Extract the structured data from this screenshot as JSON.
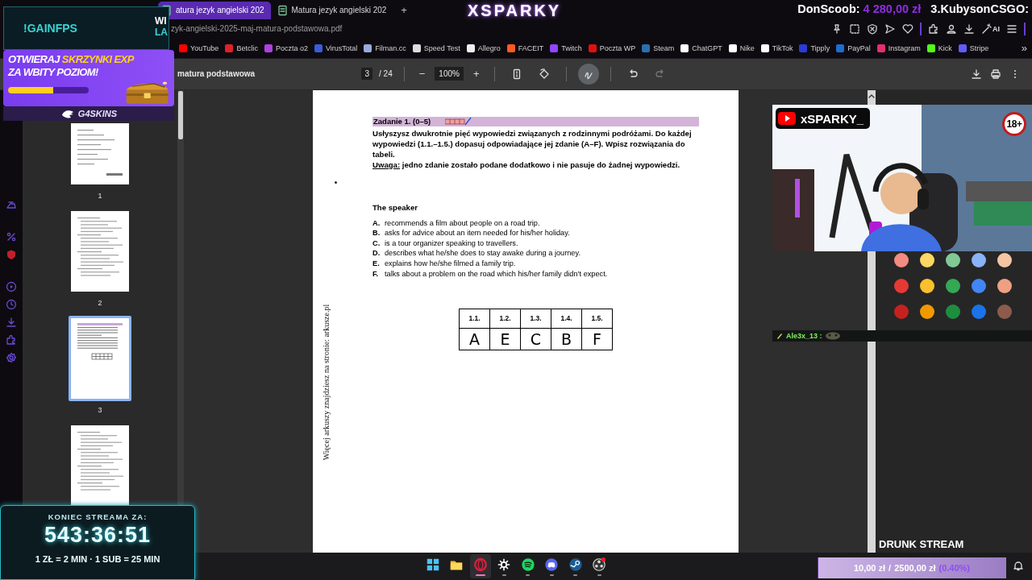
{
  "browser": {
    "tabs": [
      {
        "label": "atura jezyk angielski 202",
        "selected": true
      },
      {
        "label": "Matura jezyk angielski 202",
        "selected": false
      }
    ],
    "new_tab": "+",
    "address": "zyk-angielski-2025-maj-matura-podstawowa.pdf",
    "ai_label": "AI",
    "bookmarks": [
      {
        "label": "YouTube"
      },
      {
        "label": "Betclic"
      },
      {
        "label": "Poczta o2"
      },
      {
        "label": "VirusTotal"
      },
      {
        "label": "Filman.cc"
      },
      {
        "label": "Speed Test"
      },
      {
        "label": "Allegro"
      },
      {
        "label": "FACEIT"
      },
      {
        "label": "Twitch"
      },
      {
        "label": "Poczta WP"
      },
      {
        "label": "Steam"
      },
      {
        "label": "ChatGPT"
      },
      {
        "label": "Nike"
      },
      {
        "label": "TikTok"
      },
      {
        "label": "Tipply"
      },
      {
        "label": "PayPal"
      },
      {
        "label": "Instagram"
      },
      {
        "label": "Kick"
      },
      {
        "label": "Stripe"
      }
    ],
    "more_bookmarks": "»"
  },
  "pdf_toolbar": {
    "title": "matura podstawowa",
    "page": "3",
    "page_count": "/ 24",
    "zoom_out": "−",
    "zoom": "100%",
    "zoom_in": "+",
    "tools": [
      {
        "kind": "fit",
        "on": false,
        "disabled": false
      },
      {
        "kind": "rotate",
        "on": false,
        "disabled": false
      },
      {
        "kind": "draw",
        "on": true,
        "disabled": false
      },
      {
        "kind": "undo",
        "on": false,
        "disabled": false
      },
      {
        "kind": "redo",
        "on": false,
        "disabled": true
      }
    ]
  },
  "thumbnails": [
    {
      "label": "1",
      "selected": false,
      "kind": "cover"
    },
    {
      "label": "2",
      "selected": false,
      "kind": "text"
    },
    {
      "label": "3",
      "selected": true,
      "kind": "table"
    },
    {
      "selected": false,
      "kind": "text"
    }
  ],
  "page": {
    "task_title": "Zadanie 1. (0–5)",
    "instruction": "Usłyszysz dwukrotnie pięć wypowiedzi związanych z rodzinnymi podróżami. Do każdej wypowiedzi (1.1.–1.5.) dopasuj odpowiadające jej zdanie (A–F). Wpisz rozwiązania do tabeli.",
    "note": "**Uwaga:** jedno zdanie zostało podane dodatkowo i nie pasuje do żadnej wypowiedzi.",
    "heading": "The speaker",
    "options": [
      {
        "letter": "A.",
        "text": "recommends a film about people on a road trip."
      },
      {
        "letter": "B.",
        "text": "asks for advice about an item needed for his/her holiday."
      },
      {
        "letter": "C.",
        "text": "is a tour organizer speaking to travellers."
      },
      {
        "letter": "D.",
        "text": "describes what he/she does to stay awake during a journey."
      },
      {
        "letter": "E.",
        "text": "explains how he/she filmed a family trip."
      },
      {
        "letter": "F.",
        "text": "talks about a problem on the road which his/her family didn’t expect."
      }
    ],
    "table": {
      "columns": [
        "1.1.",
        "1.2.",
        "1.3.",
        "1.4.",
        "1.5."
      ],
      "answers": [
        "A",
        "E",
        "C",
        "B",
        "F"
      ]
    },
    "side_note": "Więcej arkuszy znajdziesz na stronie: arkusze.pl"
  },
  "color_palette": [
    {
      "color": "#f28b82"
    },
    {
      "color": "#fdd663"
    },
    {
      "color": "#81c995"
    },
    {
      "color": "#8ab4f8"
    },
    {
      "color": "#f6c5a4"
    },
    {
      "color": "#e53935"
    },
    {
      "color": "#fbc02d"
    },
    {
      "color": "#34a853"
    },
    {
      "color": "#4285f4"
    },
    {
      "color": "#eea083"
    },
    {
      "color": "#c5221f"
    },
    {
      "color": "#f29900"
    },
    {
      "color": "#1e8e3e"
    },
    {
      "color": "#1a73e8"
    },
    {
      "color": "#8d5b4c"
    }
  ],
  "taskbar": [
    {
      "kind": "start",
      "selected": false,
      "running": false
    },
    {
      "kind": "files",
      "selected": false,
      "running": false
    },
    {
      "kind": "browser",
      "selected": true,
      "running": true
    },
    {
      "kind": "gear",
      "selected": false,
      "running": true
    },
    {
      "kind": "music",
      "selected": false,
      "running": true
    },
    {
      "kind": "chat",
      "selected": false,
      "running": true
    },
    {
      "kind": "steam",
      "selected": false,
      "running": true
    },
    {
      "kind": "recorder",
      "selected": false,
      "running": true
    }
  ],
  "overlays": {
    "logo": "XSPARKY",
    "donors": [
      {
        "name": "DonScoob:",
        "amount": "4 280,00 zł"
      },
      {
        "name": "3.KubysonCSGO:"
      }
    ],
    "command": "!GAINFPS",
    "cut_words": [
      "WI",
      "LA"
    ],
    "promo": {
      "lines": [
        "OTWIERAJ **SKRZYNKI EXP**",
        "ZA WBITY POZIOM!"
      ],
      "level": 0.56,
      "brand": "G4SKINS"
    },
    "webcam": {
      "kind": "picture",
      "channel": "xSPARKY_",
      "age_badge": "18+"
    },
    "chat": {
      "user": "Ale3x_13 :"
    },
    "stream_label": "DRUNK STREAM",
    "timer": {
      "title": "KONIEC STREAMA ZA:",
      "time": "543:36:51",
      "rates": "1 ZŁ = 2 MIN · 1 SUB = 25 MIN"
    },
    "goal": {
      "current": "10,00 zł",
      "separator": "/",
      "target": "2500,00 zł",
      "percent": "(0.40%)",
      "level": 0.004
    }
  }
}
